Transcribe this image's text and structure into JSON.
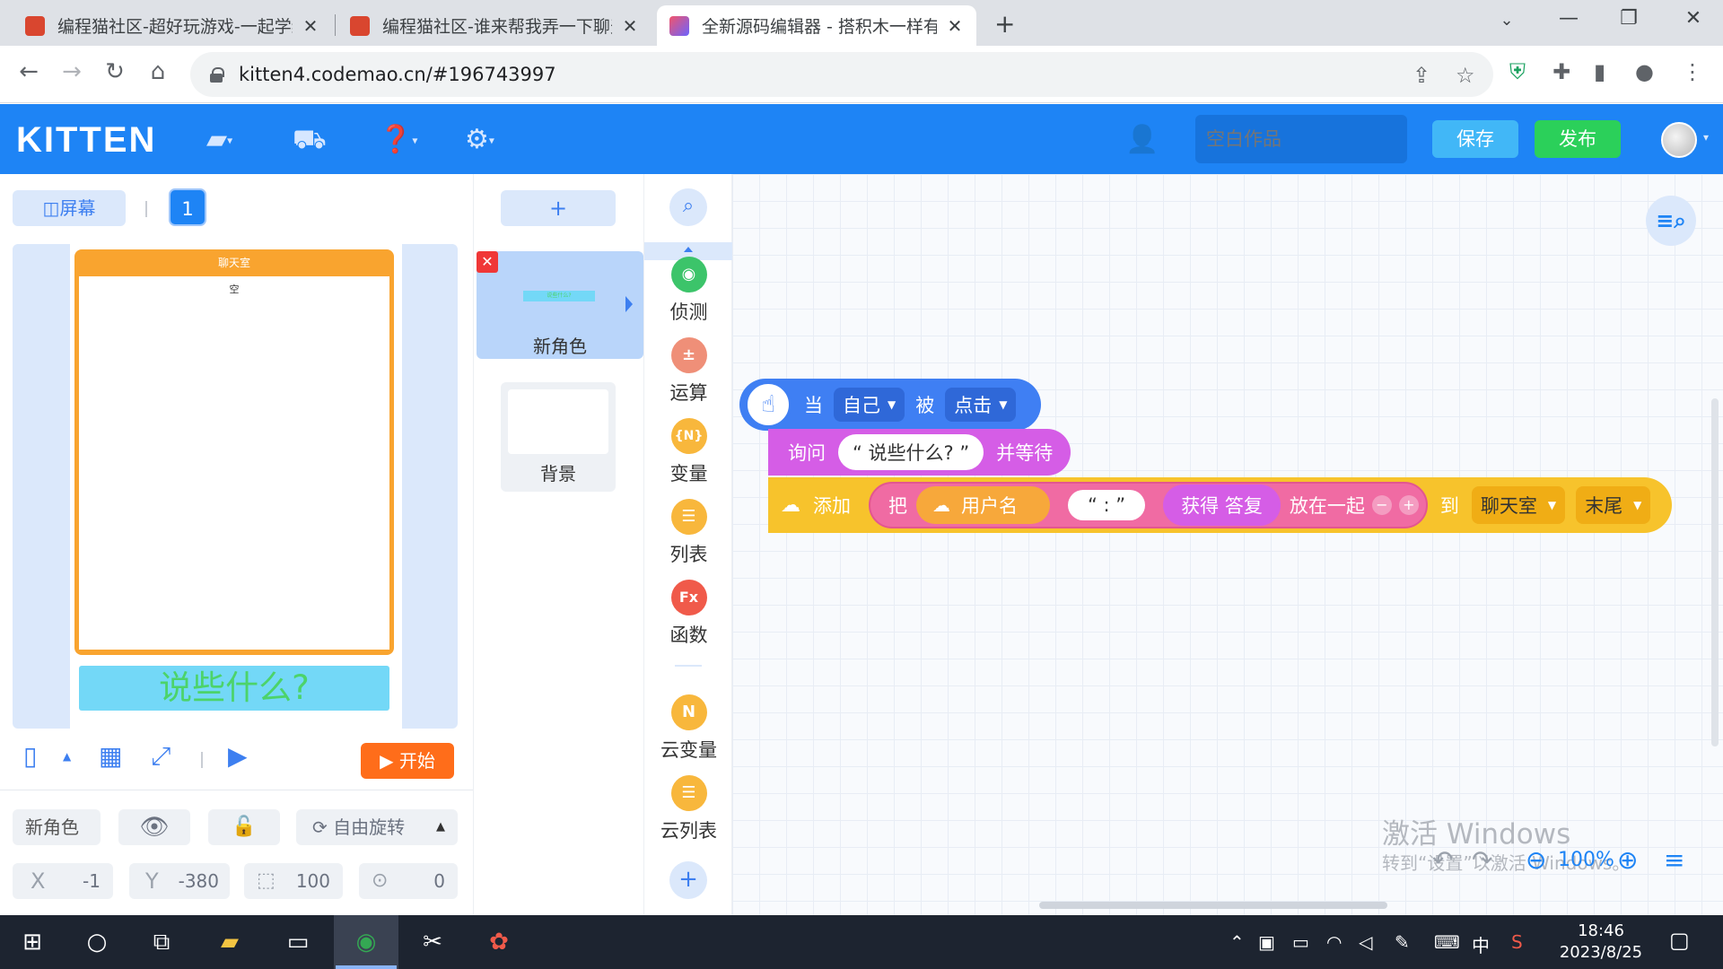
{
  "browser": {
    "tabs": [
      {
        "title": "编程猫社区-超好玩游戏-一起学编程",
        "active": false
      },
      {
        "title": "编程猫社区-谁来帮我弄一下聊天室",
        "active": false
      },
      {
        "title": "全新源码编辑器 - 搭积木一样有趣",
        "active": true
      }
    ],
    "url": "kitten4.codemao.cn/#196743997"
  },
  "header": {
    "logo": "KITTEN",
    "project_name_placeholder": "空白作品",
    "save_label": "保存",
    "publish_label": "发布"
  },
  "stage": {
    "screen_label": "屏幕",
    "screen_number": "1",
    "chat_title": "聊天室",
    "chat_content": "空",
    "ask_text": "说些什么?",
    "start_label": "开始"
  },
  "properties": {
    "sprite_name": "新角色",
    "rotation_label": "自由旋转",
    "x_label": "X",
    "x_value": "-1",
    "y_label": "Y",
    "y_value": "-380",
    "size_value": "100",
    "direction_value": "0"
  },
  "sprites": {
    "add_label": "+",
    "items": [
      {
        "label": "新角色",
        "thumb": "说些什么?"
      }
    ],
    "background_label": "背景"
  },
  "categories": [
    {
      "label": "侦测",
      "color": "#3cc46a",
      "glyph": "◉"
    },
    {
      "label": "运算",
      "color": "#ef8f78",
      "glyph": "±"
    },
    {
      "label": "变量",
      "color": "#f8b73c",
      "glyph": "{N}"
    },
    {
      "label": "列表",
      "color": "#f8b73c",
      "glyph": "☰"
    },
    {
      "label": "函数",
      "color": "#f05a4a",
      "glyph": "Fx"
    },
    {
      "label": "云变量",
      "color": "#f8b73c",
      "glyph": "N"
    },
    {
      "label": "云列表",
      "color": "#f8b73c",
      "glyph": "☰"
    }
  ],
  "blocks": {
    "event": {
      "when": "当",
      "target": "自己",
      "by": "被",
      "action": "点击"
    },
    "ask": {
      "label": "询问",
      "question": "“ 说些什么? ”",
      "wait": "并等待"
    },
    "add": {
      "label": "添加",
      "put": "把",
      "username": "用户名",
      "colon": "“ : ”",
      "answer": "获得 答复",
      "join": "放在一起",
      "to": "到",
      "list": "聊天室",
      "position": "末尾"
    }
  },
  "watermark": {
    "line1": "激活 Windows",
    "line2": "转到“设置”以激活 Windows。"
  },
  "zoom": "100%",
  "taskbar": {
    "time": "18:46",
    "date": "2023/8/25",
    "ime": "中"
  }
}
